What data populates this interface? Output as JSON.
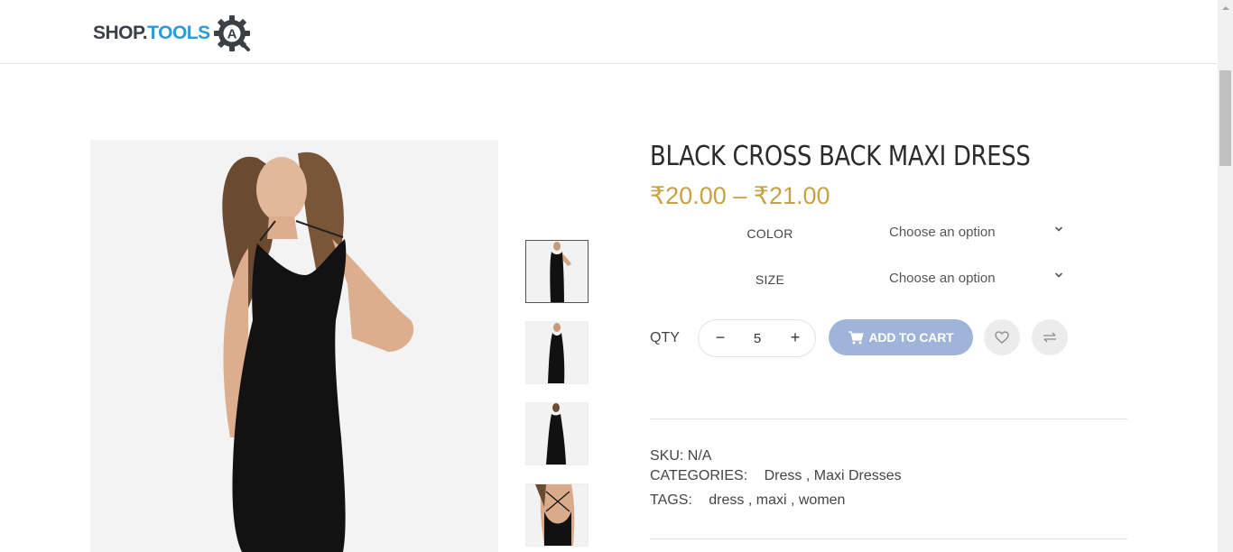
{
  "header": {
    "logo_part1": "SHOP.",
    "logo_part2": "TOOLS",
    "logo_badge_letter": "A"
  },
  "product": {
    "title": "BLACK CROSS BACK MAXI DRESS",
    "price_range": "₹20.00 – ₹21.00",
    "price_color": "#c9a145"
  },
  "variations": [
    {
      "label": "COLOR",
      "placeholder": "Choose an option"
    },
    {
      "label": "SIZE",
      "placeholder": "Choose an option"
    }
  ],
  "cart": {
    "qty_label": "QTY",
    "qty_value": "5",
    "minus_symbol": "−",
    "plus_symbol": "+",
    "add_to_cart_label": "ADD TO CART",
    "add_to_cart_color": "#a0b3d8"
  },
  "meta": {
    "sku_key": "SKU:",
    "sku_value": "N/A",
    "categories_key": "CATEGORIES:",
    "categories": [
      "Dress",
      "Maxi Dresses"
    ],
    "tags_key": "TAGS:",
    "tags": [
      "dress",
      "maxi",
      "women"
    ]
  },
  "gallery": {
    "thumb_count": 4,
    "active_thumb": 1
  }
}
